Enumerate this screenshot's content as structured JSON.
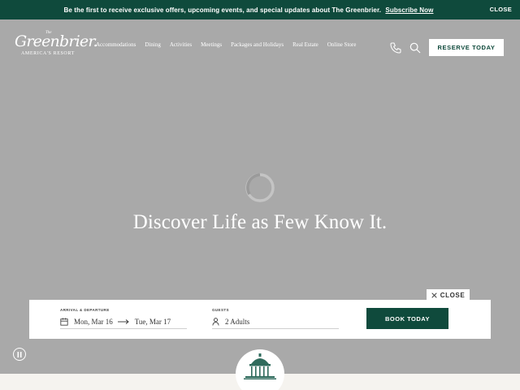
{
  "announcement": {
    "message": "Be the first to receive exclusive offers, upcoming events, and special updates about The Greenbrier.",
    "link": "Subscribe Now",
    "close": "CLOSE"
  },
  "logo": {
    "the": "The",
    "name": "Greenbrier.",
    "tagline": "AMERICA'S RESORT"
  },
  "nav": {
    "items": [
      "Accommodations",
      "Dining",
      "Activities",
      "Meetings",
      "Packages and Holidays",
      "Real Estate",
      "Online Store"
    ]
  },
  "header": {
    "reserve": "RESERVE TODAY",
    "icons": [
      "phone-icon",
      "search-icon"
    ]
  },
  "hero": {
    "headline": "Discover Life as Few Know It."
  },
  "booking": {
    "close": "CLOSE",
    "dates_label": "ARRIVAL & DEPARTURE",
    "arrival": "Mon, Mar 16",
    "departure": "Tue, Mar 17",
    "guests_label": "GUESTS",
    "guests": "2 Adults",
    "book": "BOOK TODAY"
  },
  "colors": {
    "brand_green": "#0f4a3c",
    "hero_overlay": "#a9a9a9"
  }
}
